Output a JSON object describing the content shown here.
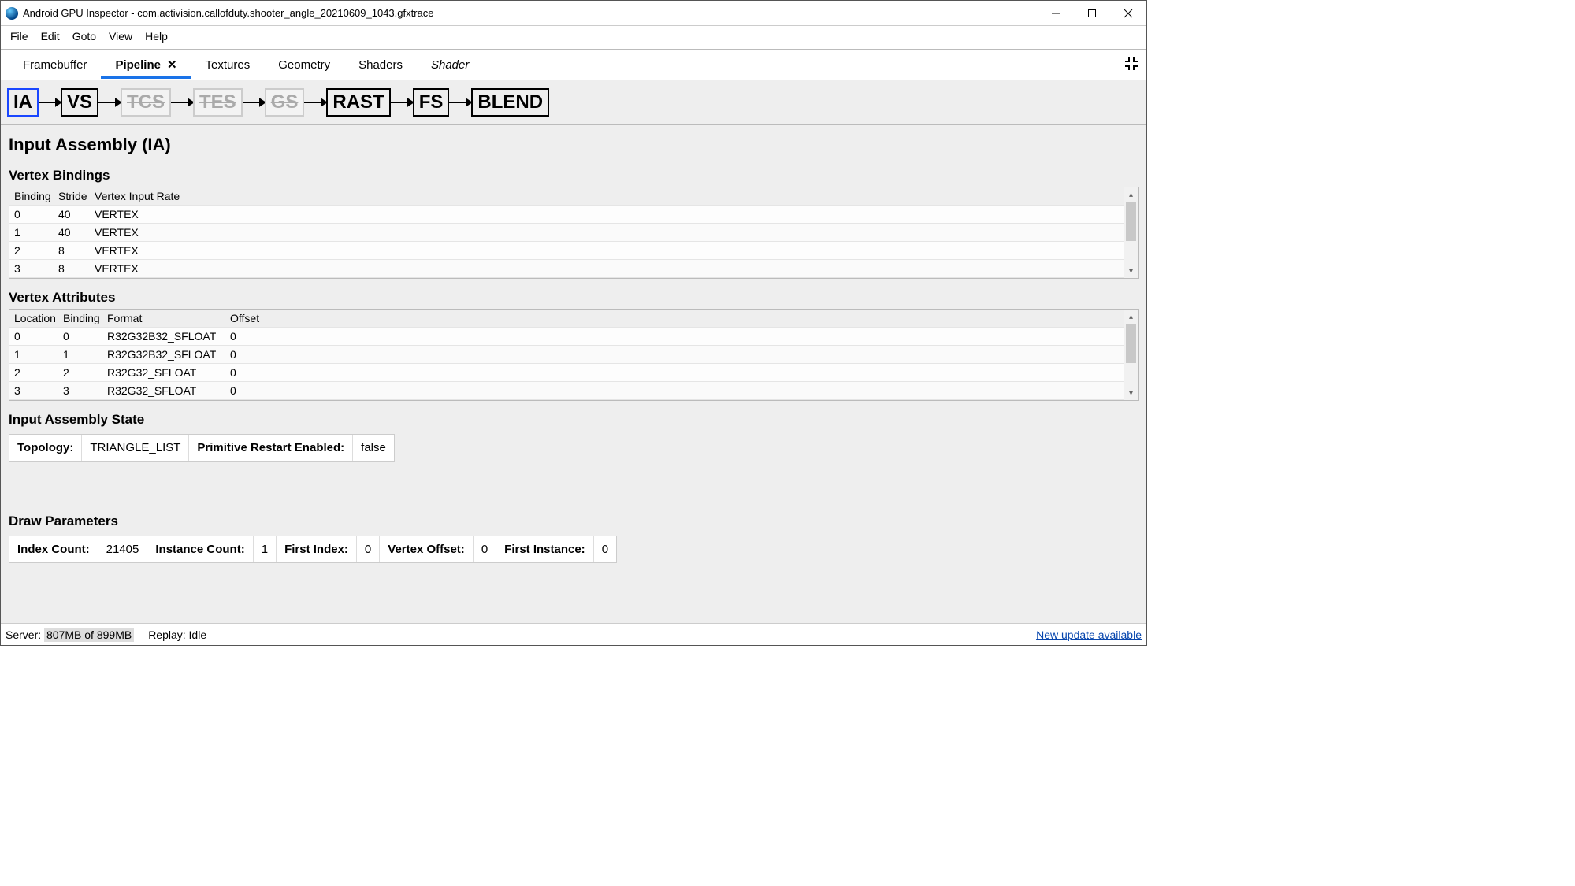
{
  "window": {
    "title": "Android GPU Inspector - com.activision.callofduty.shooter_angle_20210609_1043.gfxtrace"
  },
  "menu": {
    "items": [
      "File",
      "Edit",
      "Goto",
      "View",
      "Help"
    ]
  },
  "tabs": {
    "items": [
      {
        "label": "Framebuffer",
        "active": false,
        "closeable": false
      },
      {
        "label": "Pipeline",
        "active": true,
        "closeable": true
      },
      {
        "label": "Textures",
        "active": false,
        "closeable": false
      },
      {
        "label": "Geometry",
        "active": false,
        "closeable": false
      },
      {
        "label": "Shaders",
        "active": false,
        "closeable": false
      },
      {
        "label": "Shader",
        "active": false,
        "closeable": false,
        "italic": true
      }
    ]
  },
  "pipeline": {
    "stages": [
      {
        "label": "IA",
        "disabled": false,
        "selected": true
      },
      {
        "label": "VS",
        "disabled": false,
        "selected": false
      },
      {
        "label": "TCS",
        "disabled": true,
        "selected": false
      },
      {
        "label": "TES",
        "disabled": true,
        "selected": false
      },
      {
        "label": "GS",
        "disabled": true,
        "selected": false
      },
      {
        "label": "RAST",
        "disabled": false,
        "selected": false
      },
      {
        "label": "FS",
        "disabled": false,
        "selected": false
      },
      {
        "label": "BLEND",
        "disabled": false,
        "selected": false
      }
    ]
  },
  "section": {
    "title": "Input Assembly (IA)"
  },
  "vertex_bindings": {
    "title": "Vertex Bindings",
    "headers": [
      "Binding",
      "Stride",
      "Vertex Input Rate"
    ],
    "rows": [
      {
        "binding": "0",
        "stride": "40",
        "rate": "VERTEX"
      },
      {
        "binding": "1",
        "stride": "40",
        "rate": "VERTEX"
      },
      {
        "binding": "2",
        "stride": "8",
        "rate": "VERTEX"
      },
      {
        "binding": "3",
        "stride": "8",
        "rate": "VERTEX"
      }
    ]
  },
  "vertex_attributes": {
    "title": "Vertex Attributes",
    "headers": [
      "Location",
      "Binding",
      "Format",
      "Offset"
    ],
    "rows": [
      {
        "location": "0",
        "binding": "0",
        "format": "R32G32B32_SFLOAT",
        "offset": "0"
      },
      {
        "location": "1",
        "binding": "1",
        "format": "R32G32B32_SFLOAT",
        "offset": "0"
      },
      {
        "location": "2",
        "binding": "2",
        "format": "R32G32_SFLOAT",
        "offset": "0"
      },
      {
        "location": "3",
        "binding": "3",
        "format": "R32G32_SFLOAT",
        "offset": "0"
      }
    ]
  },
  "ia_state": {
    "title": "Input Assembly State",
    "topology_label": "Topology:",
    "topology_value": "TRIANGLE_LIST",
    "prim_restart_label": "Primitive Restart Enabled:",
    "prim_restart_value": "false"
  },
  "draw_params": {
    "title": "Draw Parameters",
    "items": [
      {
        "k": "Index Count:",
        "v": "21405"
      },
      {
        "k": "Instance Count:",
        "v": "1"
      },
      {
        "k": "First Index:",
        "v": "0"
      },
      {
        "k": "Vertex Offset:",
        "v": "0"
      },
      {
        "k": "First Instance:",
        "v": "0"
      }
    ]
  },
  "status": {
    "server_label": "Server:",
    "server_value": "807MB of 899MB",
    "replay_label": "Replay:",
    "replay_value": "Idle",
    "update_text": "New update available"
  }
}
